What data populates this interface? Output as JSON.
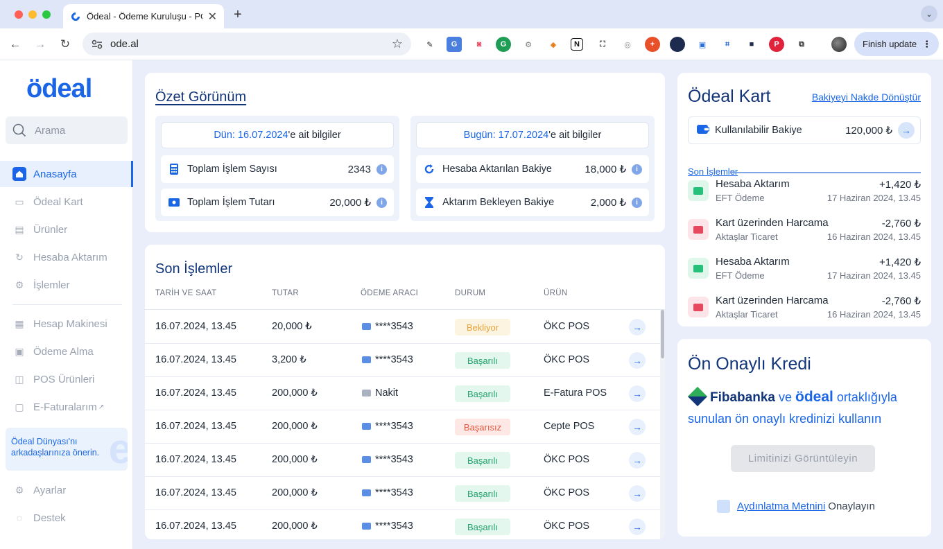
{
  "browser": {
    "tab_title": "Ödeal - Ödeme Kuruluşu - PC",
    "url": "ode.al",
    "finish_update": "Finish update"
  },
  "sidebar": {
    "logo": "ödeal",
    "search_placeholder": "Arama",
    "items": [
      {
        "label": "Anasayfa",
        "icon": "home-icon",
        "active": true
      },
      {
        "label": "Ödeal Kart",
        "icon": "card-icon"
      },
      {
        "label": "Ürünler",
        "icon": "products-icon"
      },
      {
        "label": "Hesaba Aktarım",
        "icon": "transfer-icon"
      },
      {
        "label": "İşlemler",
        "icon": "transactions-icon"
      },
      {
        "label": "Hesap Makinesi",
        "icon": "calculator-icon"
      },
      {
        "label": "Ödeme Alma",
        "icon": "payment-icon"
      },
      {
        "label": "POS Ürünleri",
        "icon": "basket-icon"
      },
      {
        "label": "E-Faturalarım",
        "icon": "invoice-icon"
      },
      {
        "label": "Ayarlar",
        "icon": "gear-icon"
      },
      {
        "label": "Destek",
        "icon": "chat-icon"
      }
    ],
    "promo": "Ödeal Dünyası'nı arkadaşlarınıza önerin."
  },
  "summary": {
    "title": "Özet Görünüm",
    "yesterday": {
      "head_prefix": "Dün: 16.07.2024",
      "head_suffix": "'e ait bilgiler",
      "rows": [
        {
          "label": "Toplam İşlem Sayısı",
          "value": "2343"
        },
        {
          "label": "Toplam İşlem Tutarı",
          "value": "20,000 ₺"
        }
      ]
    },
    "today": {
      "head_prefix": "Bugün: 17.07.2024",
      "head_suffix": "'e ait bilgiler",
      "rows": [
        {
          "label": "Hesaba Aktarılan Bakiye",
          "value": "18,000 ₺"
        },
        {
          "label": "Aktarım Bekleyen Bakiye",
          "value": "2,000 ₺"
        }
      ]
    }
  },
  "transactions": {
    "title": "Son İşlemler",
    "columns": [
      "TARİH VE SAAT",
      "TUTAR",
      "ÖDEME ARACI",
      "DURUM",
      "ÜRÜN"
    ],
    "rows": [
      {
        "date": "16.07.2024, 13.45",
        "amount": "20,000 ₺",
        "method": "****3543",
        "status": "Bekliyor",
        "product": "ÖKC POS"
      },
      {
        "date": "16.07.2024, 13.45",
        "amount": "3,200 ₺",
        "method": "****3543",
        "status": "Başarılı",
        "product": "ÖKC POS"
      },
      {
        "date": "16.07.2024, 13.45",
        "amount": "200,000 ₺",
        "method": "Nakit",
        "status": "Başarılı",
        "product": "E-Fatura POS"
      },
      {
        "date": "16.07.2024, 13.45",
        "amount": "200,000 ₺",
        "method": "****3543",
        "status": "Başarısız",
        "product": "Cepte POS"
      },
      {
        "date": "16.07.2024, 13.45",
        "amount": "200,000 ₺",
        "method": "****3543",
        "status": "Başarılı",
        "product": "ÖKC POS"
      },
      {
        "date": "16.07.2024, 13.45",
        "amount": "200,000 ₺",
        "method": "****3543",
        "status": "Başarılı",
        "product": "ÖKC POS"
      },
      {
        "date": "16.07.2024, 13.45",
        "amount": "200,000 ₺",
        "method": "****3543",
        "status": "Başarılı",
        "product": "ÖKC POS"
      }
    ]
  },
  "kart": {
    "title": "Ödeal Kart",
    "convert_link": "Bakiyeyi Nakde Dönüştür",
    "balance_label": "Kullanılabilir Bakiye",
    "balance_value": "120,000 ₺",
    "recent_label": "Son İşlemler",
    "recent": [
      {
        "title": "Hesaba Aktarım",
        "sub": "EFT Ödeme",
        "amount": "+1,420 ₺",
        "date": "17 Haziran 2024, 13.45",
        "type": "in"
      },
      {
        "title": "Kart üzerinden Harcama",
        "sub": "Aktaşlar Ticaret",
        "amount": "-2,760 ₺",
        "date": "16 Haziran 2024, 13.45",
        "type": "out"
      },
      {
        "title": "Hesaba Aktarım",
        "sub": "EFT Ödeme",
        "amount": "+1,420 ₺",
        "date": "17 Haziran 2024, 13.45",
        "type": "in"
      },
      {
        "title": "Kart üzerinden Harcama",
        "sub": "Aktaşlar Ticaret",
        "amount": "-2,760 ₺",
        "date": "16 Haziran 2024, 13.45",
        "type": "out"
      }
    ]
  },
  "kredi": {
    "title": "Ön Onaylı Kredi",
    "bank": "Fibabanka",
    "connector": "ve",
    "brand": "ödeal",
    "line1_suffix": "ortaklığıyla",
    "line2": "sunulan ön onaylı kredinizi kullanın",
    "button": "Limitinizi Görüntüleyin",
    "consent_link": "Aydınlatma Metnini",
    "consent_suffix": "Onaylayın"
  },
  "colors": {
    "accent": "#1a66e6",
    "navy": "#12357a",
    "success": "#1ea36b",
    "warning": "#e0a43a",
    "danger": "#e4573f"
  }
}
